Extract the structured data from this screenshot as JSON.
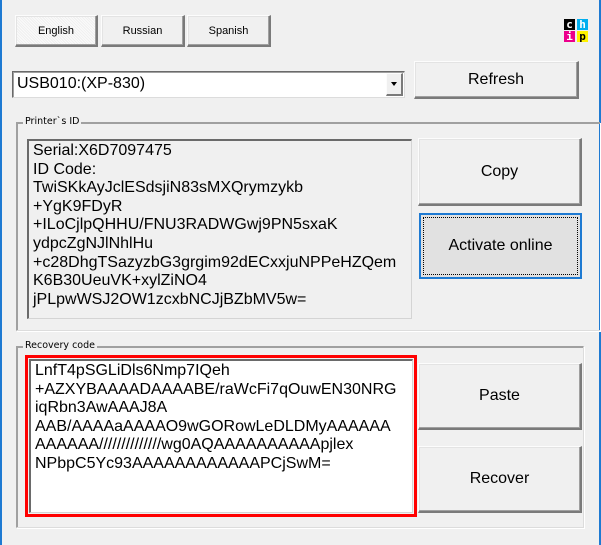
{
  "language_tabs": [
    {
      "label": "English",
      "active": true
    },
    {
      "label": "Russian",
      "active": false
    },
    {
      "label": "Spanish",
      "active": false
    }
  ],
  "logo": {
    "name": "chip-logo-icon",
    "letters": [
      "c",
      "h",
      "i",
      "p"
    ],
    "colors": [
      "#000000",
      "#00aeef",
      "#ec008c",
      "#fff200"
    ]
  },
  "printer_select": {
    "selected_value": "USB010:(XP-830)"
  },
  "toolbar": {
    "refresh_label": "Refresh"
  },
  "printer_id": {
    "group_label": "Printer`s ID",
    "text": "Serial:X6D7097475\nID Code:\nTwiSKkAyJclESdsjiN83sMXQrymzykb\n+YgK9FDyR\n+ILoCjlpQHHU/FNU3RADWGwj9PN5sxaK\nydpcZgNJlNhlHu\n+c28DhgTSazyzbG3grgim92dECxxjuNPPeHZQem\nK6B30UeuVK+xylZiNO4\njPLpwWSJ2OW1zcxbNCJjBZbMV5w=",
    "copy_label": "Copy",
    "activate_label": "Activate online"
  },
  "recovery": {
    "group_label": "Recovery code",
    "text": "LnfT4pSGLiDls6Nmp7IQeh\n+AZXYBAAAADAAAABE/raWcFi7qOuwEN30NRG\niqRbn3AwAAAJ8A\nAAB/AAAAaAAAAO9wGORowLeDLDMyAAAAAA\nAAAAAA//////////////wg0AQAAAAAAAAAApjlex\nNPbpC5Yc93AAAAAAAAAAAAPCjSwM=",
    "highlight_color": "#ff0000",
    "paste_label": "Paste",
    "recover_label": "Recover"
  },
  "colors": {
    "window_border": "#1e7ad2",
    "focus_border": "#1e7ad2"
  }
}
